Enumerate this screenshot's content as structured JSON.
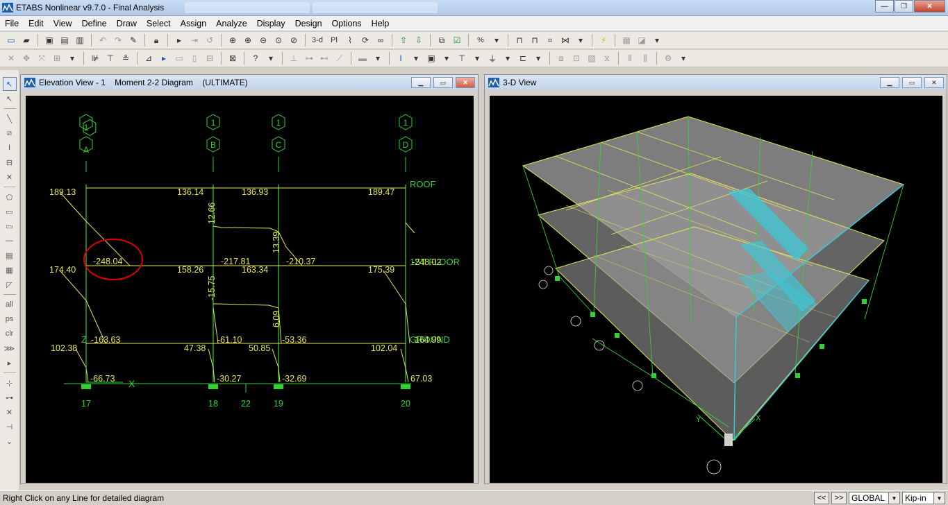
{
  "app": {
    "title": "ETABS Nonlinear v9.7.0 - Final Analysis",
    "window_controls": {
      "minimize": "—",
      "restore": "❐",
      "close": "✕"
    }
  },
  "menu": [
    "File",
    "Edit",
    "View",
    "Define",
    "Draw",
    "Select",
    "Assign",
    "Analyze",
    "Display",
    "Design",
    "Options",
    "Help"
  ],
  "toolbar1": {
    "icons": [
      "new-icon",
      "open-icon",
      "save-icon",
      "print-icon",
      "print-preview-icon",
      "undo-icon",
      "redo-icon",
      "pencil-icon",
      "lock-icon",
      "run-icon",
      "step-icon",
      "pause-icon",
      "zoom-window-icon",
      "zoom-in-icon",
      "zoom-out-icon",
      "zoom-extents-icon",
      "zoom-prev-icon",
      "view-3d-icon",
      "plan-view-icon",
      "elevation-view-icon",
      "rotate-icon",
      "perspective-icon",
      "move-up-icon",
      "move-down-icon",
      "object-shrink-icon",
      "set-building-options-icon",
      "percent-icon",
      "frame-icon",
      "frame-forces-icon",
      "shell-forces-icon",
      "reactions-icon",
      "lightning-icon",
      "deformed-shape-icon",
      "mode-shape-icon"
    ],
    "labels": {
      "view_3d": "3-d",
      "plan": "Pl",
      "percent": "%"
    }
  },
  "toolbar2": {
    "icons": [
      "pointer-grid-icon",
      "snap-icon",
      "intersect-icon",
      "offsets-icon",
      "draw-frame-icon",
      "draw-column-icon",
      "draw-beam-icon",
      "draw-area-icon",
      "draw-wall-icon",
      "draw-opening-icon",
      "draw-strip-icon",
      "draw-dim-icon",
      "info-icon",
      "select-all-icon",
      "beam-line-icon",
      "column-line-icon",
      "brace-icon",
      "floor-icon",
      "wall-icon",
      "section-icon",
      "material-icon",
      "load-icon",
      "restraint-icon",
      "spring-icon",
      "design-icon",
      "steel-icon",
      "concrete-icon",
      "composite-icon",
      "check-icon"
    ]
  },
  "left_toolbar": {
    "icons": [
      "select-pointer-icon",
      "reshape-icon",
      "draw-line-icon",
      "draw-brace-icon",
      "draw-column-icon",
      "draw-frame-icon",
      "delete-icon",
      "draw-area-icon",
      "draw-rect-icon",
      "draw-poly-icon",
      "draw-wall-icon",
      "draw-opening-icon",
      "draw-strip-icon",
      "draw-ramp-icon",
      "select-all-icon",
      "select-previous-icon",
      "clear-selection-icon",
      "snap-grid-icon",
      "snap-point-icon",
      "snap-middle-icon",
      "snap-intersect-icon",
      "snap-perpendicular-icon"
    ],
    "labels": {
      "all": "all",
      "ps": "ps",
      "clr": "clr"
    }
  },
  "elevation_window": {
    "title": "Elevation View - 1    Moment 2-2 Diagram    (ULTIMATE)",
    "grid_bubbles": [
      {
        "top": "1",
        "bottom": "A"
      },
      {
        "top": "1",
        "bottom": "B"
      },
      {
        "top": "1",
        "bottom": "C"
      },
      {
        "top": "1",
        "bottom": "D"
      }
    ],
    "story_labels": [
      "ROOF",
      "1ST FLOOR",
      "GROUND"
    ],
    "story_label_overlap_values": [
      "-248.02",
      "164.99",
      "67.03"
    ],
    "moment_values": {
      "roof_left": "189.13",
      "roof_ab_right": "136.14",
      "roof_bc_left": "136.93",
      "roof_right": "189.47",
      "roof_b_mid": "12.66",
      "roof_c_mid": "13.39",
      "floor1_span1_mid": "-248.04",
      "floor1_span2_mid": "-217.81",
      "floor1_span3_mid": "-210.37",
      "floor1_left": "174.40",
      "floor1_b_right": "158.26",
      "floor1_c_left": "163.34",
      "floor1_right": "175.39",
      "floor1_b_mid": "-15.75",
      "floor1_c_mid": "6.09",
      "ground_span1_mid": "-163.63",
      "ground_span2_mid": "-61.10",
      "ground_span3_mid": "-53.36",
      "ground_left": "102.38",
      "ground_b": "47.38",
      "ground_c": "50.85",
      "ground_right": "102.04",
      "base_a": "-66.73",
      "base_b": "-30.27",
      "base_c": "-32.69"
    },
    "base_labels": [
      "17",
      "18",
      "22",
      "19",
      "20"
    ],
    "axis_labels": {
      "z": "Z",
      "x": "X"
    }
  },
  "view3d_window": {
    "title": "3-D View",
    "axis_labels": {
      "y": "Y",
      "x": "X"
    }
  },
  "statusbar": {
    "message": "Right Click on any Line for detailed diagram",
    "prev_label": "<<",
    "next_label": ">>",
    "coord_system": "GLOBAL",
    "units": "Kip-in"
  },
  "colors": {
    "structure_green": "#32d232",
    "diagram_yellow": "#e6e65a",
    "highlight_red": "#e00000",
    "panel_cyan": "#3cc8d8"
  }
}
